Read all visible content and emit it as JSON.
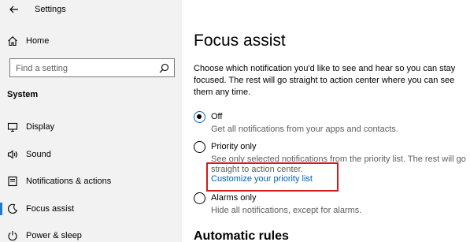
{
  "window": {
    "title": "Settings"
  },
  "sidebar": {
    "home_label": "Home",
    "search_placeholder": "Find a setting",
    "section_title": "System",
    "items": [
      {
        "label": "Display",
        "icon": "display-icon"
      },
      {
        "label": "Sound",
        "icon": "sound-icon"
      },
      {
        "label": "Notifications & actions",
        "icon": "notifications-icon"
      },
      {
        "label": "Focus assist",
        "icon": "focus-assist-icon",
        "active": true
      },
      {
        "label": "Power & sleep",
        "icon": "power-icon"
      }
    ]
  },
  "main": {
    "title": "Focus assist",
    "description": "Choose which notification you'd like to see and hear so you can stay focused. The rest will go straight to action center where you can see them any time.",
    "options": [
      {
        "label": "Off",
        "description": "Get all notifications from your apps and contacts.",
        "selected": true
      },
      {
        "label": "Priority only",
        "description": "See only selected notifications from the priority list. The rest will go straight to action center.",
        "selected": false
      },
      {
        "label": "Alarms only",
        "description": "Hide all notifications, except for alarms.",
        "selected": false
      }
    ],
    "priority_link": "Customize your priority list",
    "automatic_rules_heading": "Automatic rules"
  },
  "colors": {
    "sidebar_bg": "#f2f2f2",
    "accent": "#0063b1",
    "highlight": "#d11b1b"
  }
}
